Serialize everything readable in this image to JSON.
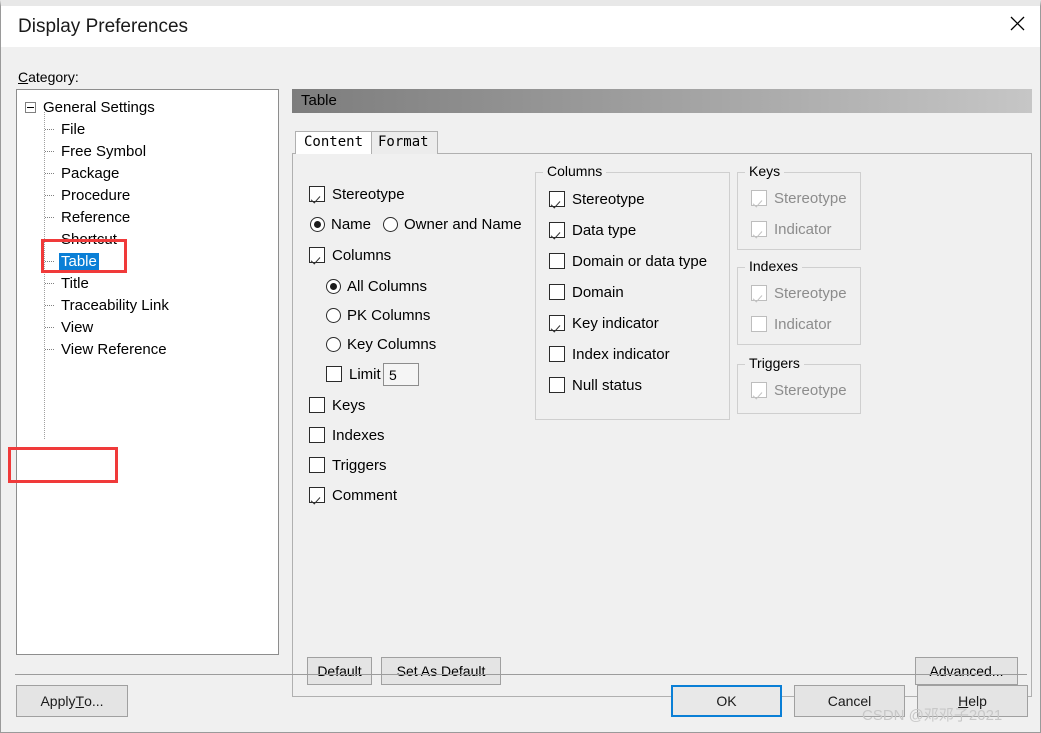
{
  "window": {
    "title": "Display Preferences",
    "close_icon": "close-x-icon"
  },
  "category": {
    "label_prefix": "C",
    "label_rest": "ategory:",
    "tree": {
      "root": "General Settings",
      "items": [
        "File",
        "Free Symbol",
        "Package",
        "Procedure",
        "Reference",
        "Shortcut",
        "Table",
        "Title",
        "Traceability Link",
        "View",
        "View Reference"
      ],
      "selected": "Table"
    }
  },
  "panel": {
    "header_title": "Table",
    "tabs": [
      {
        "label": "Content",
        "active": true
      },
      {
        "label": "Format",
        "active": false
      }
    ],
    "left_column": {
      "stereotype": {
        "label": "Stereotype",
        "checked": true
      },
      "name_radio": {
        "label": "Name",
        "selected": true
      },
      "owner_and_name_radio": {
        "label": "Owner and Name",
        "selected": false
      },
      "columns": {
        "label": "Columns",
        "checked": true
      },
      "all_columns_radio": {
        "label": "All Columns",
        "selected": true
      },
      "pk_columns_radio": {
        "label": "PK Columns",
        "selected": false
      },
      "key_columns_radio": {
        "label": "Key Columns",
        "selected": false
      },
      "limit": {
        "label": "Limit",
        "checked": false,
        "value": "5"
      },
      "keys": {
        "label": "Keys",
        "checked": false
      },
      "indexes": {
        "label": "Indexes",
        "checked": false
      },
      "triggers": {
        "label": "Triggers",
        "checked": false
      },
      "comment": {
        "label": "Comment",
        "checked": true
      }
    },
    "columns_group": {
      "title": "Columns",
      "items": [
        {
          "label": "Stereotype",
          "checked": true
        },
        {
          "label": "Data type",
          "checked": true
        },
        {
          "label": "Domain or data type",
          "checked": false
        },
        {
          "label": "Domain",
          "checked": false
        },
        {
          "label": "Key indicator",
          "checked": true
        },
        {
          "label": "Index indicator",
          "checked": false
        },
        {
          "label": "Null status",
          "checked": false
        }
      ]
    },
    "keys_group": {
      "title": "Keys",
      "items": [
        {
          "label": "Stereotype",
          "checked": true,
          "disabled": true
        },
        {
          "label": "Indicator",
          "checked": true,
          "disabled": true
        }
      ]
    },
    "indexes_group": {
      "title": "Indexes",
      "items": [
        {
          "label": "Stereotype",
          "checked": true,
          "disabled": true
        },
        {
          "label": "Indicator",
          "checked": false,
          "disabled": true
        }
      ]
    },
    "triggers_group": {
      "title": "Triggers",
      "items": [
        {
          "label": "Stereotype",
          "checked": true,
          "disabled": true
        }
      ]
    },
    "buttons": {
      "default": "Default",
      "set_as_default": "Set As Default",
      "advanced": "Advanced..."
    }
  },
  "footer": {
    "apply_to_pre": "Apply ",
    "apply_to_accel": "T",
    "apply_to_post": "o...",
    "ok": "OK",
    "cancel": "Cancel",
    "help_accel": "H",
    "help_post": "elp"
  },
  "watermark": "CSDN @邓邓子2021",
  "colors": {
    "selection_blue": "#0a7fd6",
    "annotation_red": "#f03a3a",
    "dialog_bg": "#f0f0f0"
  }
}
